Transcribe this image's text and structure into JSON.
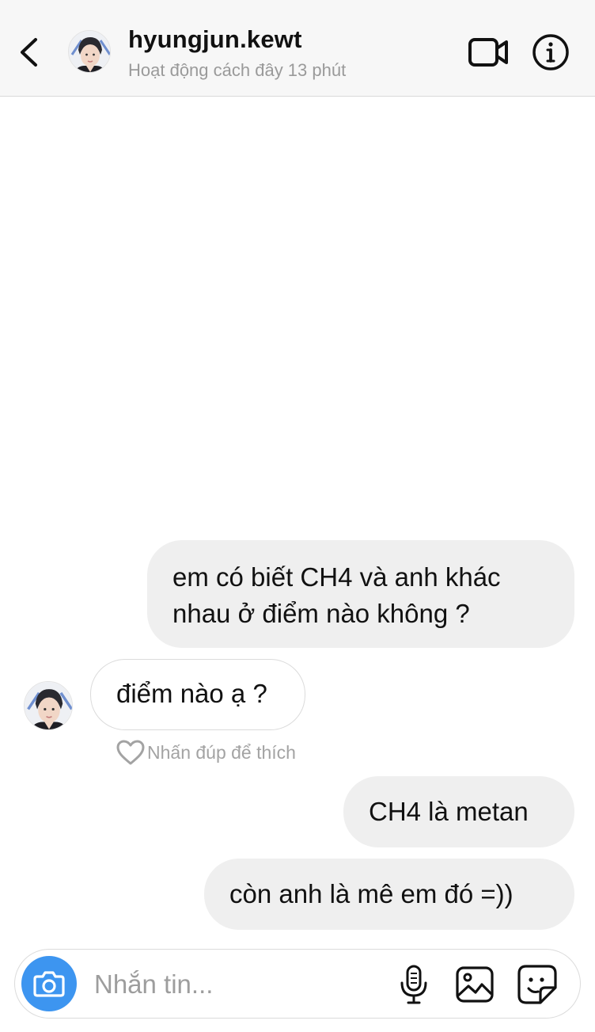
{
  "header": {
    "username": "hyungjun.kewt",
    "activity_status": "Hoạt động cách đây 13 phút"
  },
  "messages": [
    {
      "direction": "sent",
      "lines": [
        "em có biết CH4 và anh khác",
        "nhau ở điểm nào không ?"
      ]
    },
    {
      "direction": "received",
      "text": "điểm nào ạ ?"
    },
    {
      "direction": "sent",
      "text": "CH4 là metan"
    },
    {
      "direction": "sent",
      "text": "còn anh là mê em đó =))"
    }
  ],
  "like_hint": "Nhấn đúp để thích",
  "composer": {
    "placeholder": "Nhắn tin..."
  },
  "icons": {
    "back": "chevron-left-icon",
    "video": "video-camera-icon",
    "info": "info-icon",
    "camera": "camera-icon",
    "mic": "microphone-icon",
    "gallery": "image-icon",
    "sticker": "sticker-icon",
    "heart": "heart-outline-icon"
  },
  "colors": {
    "header_bg": "#f7f7f7",
    "sent_bubble": "#efefef",
    "received_bubble_border": "#dbdbdb",
    "camera_button": "#3d95f0",
    "muted_text": "#9a9a9a"
  }
}
